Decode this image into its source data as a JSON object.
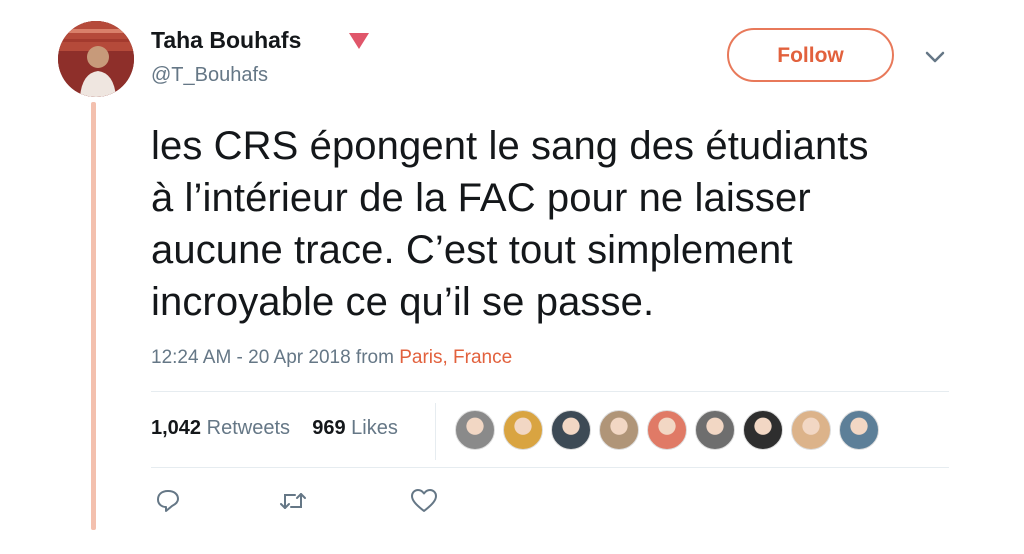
{
  "user": {
    "name": "Taha Bouhafs",
    "handle": "@T_Bouhafs",
    "avatar_icon": "profile-photo"
  },
  "follow_label": "Follow",
  "tweet": {
    "lines": [
      "les CRS épongent le sang des étudiants",
      "à l’intérieur de la FAC pour ne laisser",
      "aucune trace. C’est tout simplement",
      "incroyable ce qu’il se passe."
    ]
  },
  "meta": {
    "timestamp": "12:24 AM - 20 Apr 2018 from",
    "location": "Paris, France"
  },
  "stats": {
    "retweets_count": "1,042",
    "retweets_label": "Retweets",
    "likes_count": "969",
    "likes_label": "Likes"
  },
  "likers": [
    {
      "icon": "liker-avatar-1",
      "color": "#8a8a8a"
    },
    {
      "icon": "liker-avatar-2",
      "color": "#d9a441"
    },
    {
      "icon": "liker-avatar-3",
      "color": "#3d4a55"
    },
    {
      "icon": "liker-avatar-4",
      "color": "#b09578"
    },
    {
      "icon": "liker-avatar-5",
      "color": "#e07a66"
    },
    {
      "icon": "liker-avatar-6",
      "color": "#6e6e6e"
    },
    {
      "icon": "liker-avatar-7",
      "color": "#2e2e2e"
    },
    {
      "icon": "liker-avatar-8",
      "color": "#dcb38a"
    },
    {
      "icon": "liker-avatar-9",
      "color": "#5d7f98"
    }
  ],
  "colors": {
    "accent": "#e2613d",
    "thread_line": "#f3c0ae",
    "muted_text": "#657786"
  },
  "icons": {
    "verified": "verified-triangle-icon",
    "more": "chevron-down-icon",
    "reply": "reply-icon",
    "retweet": "retweet-icon",
    "like": "heart-icon"
  }
}
